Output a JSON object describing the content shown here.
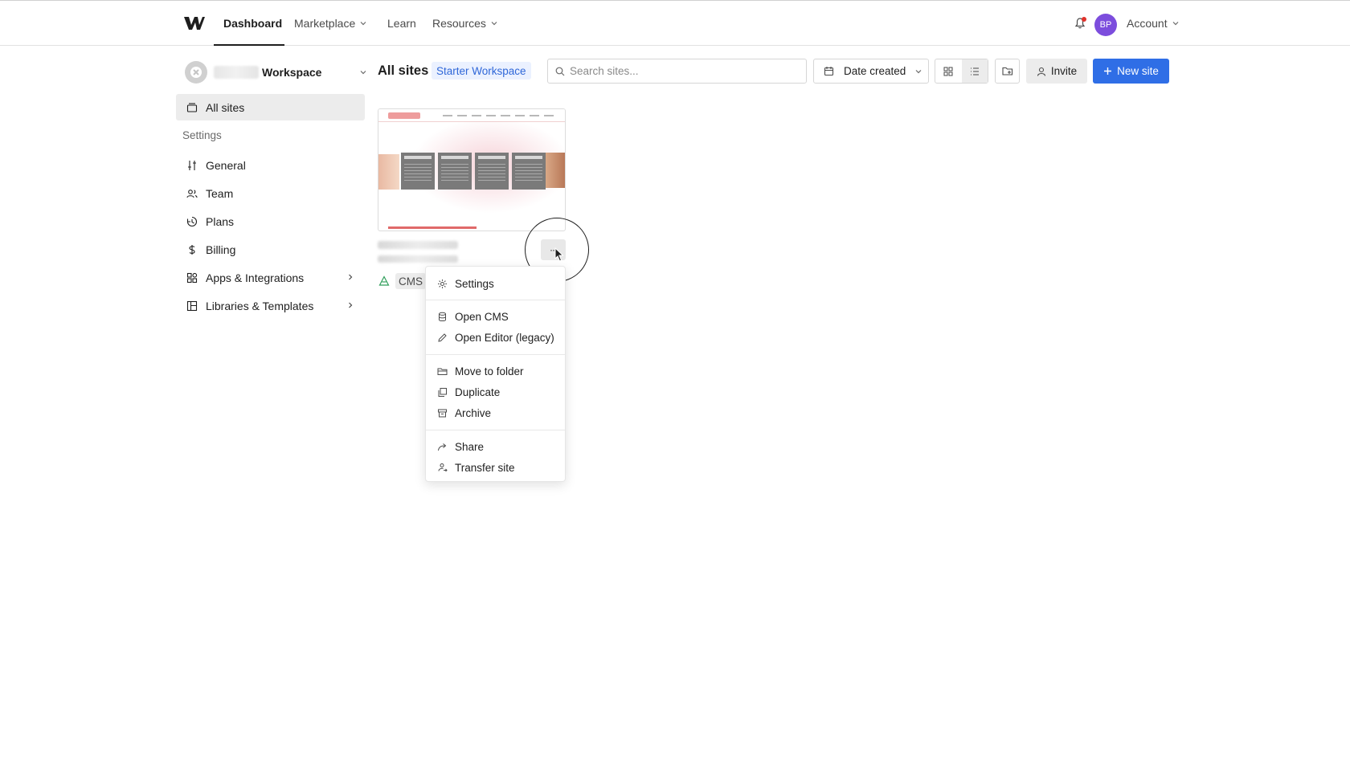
{
  "nav": {
    "items": [
      {
        "label": "Dashboard",
        "active": true
      },
      {
        "label": "Marketplace",
        "dropdown": true
      },
      {
        "label": "Learn"
      },
      {
        "label": "Resources",
        "dropdown": true
      }
    ],
    "avatar_initials": "BP",
    "account_label": "Account",
    "notification_dot_color": "#e0322b",
    "avatar_color": "#7c4ddd"
  },
  "sidebar": {
    "workspace_name": "Workspace",
    "all_sites_label": "All sites",
    "settings_heading": "Settings",
    "items": [
      {
        "label": "General",
        "icon": "sliders-icon"
      },
      {
        "label": "Team",
        "icon": "users-icon"
      },
      {
        "label": "Plans",
        "icon": "plans-icon"
      },
      {
        "label": "Billing",
        "icon": "dollar-icon"
      },
      {
        "label": "Apps & Integrations",
        "icon": "apps-icon",
        "expandable": true
      },
      {
        "label": "Libraries & Templates",
        "icon": "library-icon",
        "expandable": true
      }
    ]
  },
  "header": {
    "title": "All sites",
    "plan_badge": "Starter Workspace",
    "search_placeholder": "Search sites...",
    "sort_label": "Date created",
    "invite_label": "Invite",
    "new_site_label": "New site",
    "accent_color": "#2f6ee6"
  },
  "site_card": {
    "tag": "CMS",
    "more_label": "···"
  },
  "context_menu": {
    "items": [
      {
        "label": "Settings",
        "icon": "gear-icon"
      },
      {
        "label": "Open CMS",
        "icon": "database-icon"
      },
      {
        "label": "Open Editor (legacy)",
        "icon": "pencil-icon"
      },
      {
        "label": "Move to folder",
        "icon": "folder-icon"
      },
      {
        "label": "Duplicate",
        "icon": "duplicate-icon"
      },
      {
        "label": "Archive",
        "icon": "archive-icon"
      },
      {
        "label": "Share",
        "icon": "share-icon"
      },
      {
        "label": "Transfer site",
        "icon": "transfer-icon"
      }
    ]
  }
}
